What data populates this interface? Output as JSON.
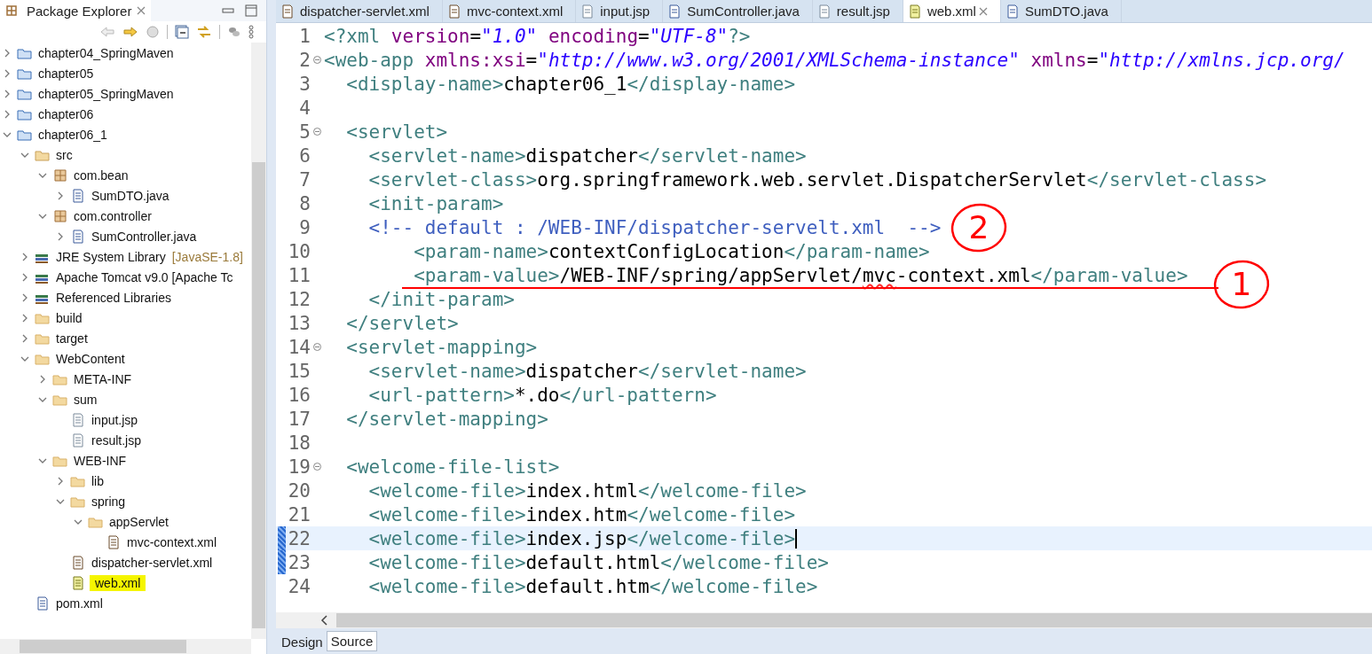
{
  "explorer": {
    "title": "Package Explorer",
    "tree": [
      {
        "label": "chapter04_SpringMaven",
        "kind": "project",
        "expanded": false,
        "selected": false
      },
      {
        "label": "chapter05",
        "kind": "project",
        "expanded": false,
        "selected": false
      },
      {
        "label": "chapter05_SpringMaven",
        "kind": "project",
        "expanded": false,
        "selected": false
      },
      {
        "label": "chapter06",
        "kind": "project",
        "expanded": false,
        "selected": false
      },
      {
        "label": "chapter06_1",
        "kind": "project",
        "expanded": true,
        "selected": false,
        "children": [
          {
            "label": "src",
            "kind": "src",
            "expanded": true,
            "selected": false,
            "children": [
              {
                "label": "com.bean",
                "kind": "package",
                "expanded": true,
                "selected": false,
                "children": [
                  {
                    "label": "SumDTO.java",
                    "kind": "java",
                    "expanded": false,
                    "selected": false
                  }
                ]
              },
              {
                "label": "com.controller",
                "kind": "package",
                "expanded": true,
                "selected": false,
                "children": [
                  {
                    "label": "SumController.java",
                    "kind": "java",
                    "expanded": false,
                    "selected": false
                  }
                ]
              }
            ]
          },
          {
            "label": "JRE System Library",
            "decoration": "[JavaSE-1.8]",
            "kind": "library",
            "expanded": false,
            "selected": false
          },
          {
            "label": "Apache Tomcat v9.0 [Apache Tc",
            "kind": "library",
            "expanded": false,
            "selected": false
          },
          {
            "label": "Referenced Libraries",
            "kind": "library",
            "expanded": false,
            "selected": false
          },
          {
            "label": "build",
            "kind": "folder",
            "expanded": false,
            "selected": false
          },
          {
            "label": "target",
            "kind": "folder",
            "expanded": false,
            "selected": false
          },
          {
            "label": "WebContent",
            "kind": "folder",
            "expanded": true,
            "selected": false,
            "children": [
              {
                "label": "META-INF",
                "kind": "folder",
                "expanded": false,
                "selected": false
              },
              {
                "label": "sum",
                "kind": "folder",
                "expanded": true,
                "selected": false,
                "children": [
                  {
                    "label": "input.jsp",
                    "kind": "jsp",
                    "selected": false
                  },
                  {
                    "label": "result.jsp",
                    "kind": "jsp",
                    "selected": false
                  }
                ]
              },
              {
                "label": "WEB-INF",
                "kind": "folder",
                "expanded": true,
                "selected": false,
                "children": [
                  {
                    "label": "lib",
                    "kind": "folder",
                    "expanded": false,
                    "selected": false
                  },
                  {
                    "label": "spring",
                    "kind": "folder",
                    "expanded": true,
                    "selected": false,
                    "children": [
                      {
                        "label": "appServlet",
                        "kind": "folder",
                        "expanded": true,
                        "selected": false,
                        "children": [
                          {
                            "label": "mvc-context.xml",
                            "kind": "spring",
                            "selected": false
                          }
                        ]
                      }
                    ]
                  },
                  {
                    "label": "dispatcher-servlet.xml",
                    "kind": "spring",
                    "selected": false
                  },
                  {
                    "label": "web.xml",
                    "kind": "xml",
                    "selected": true
                  }
                ]
              }
            ]
          },
          {
            "label": "pom.xml",
            "kind": "pom",
            "selected": false
          }
        ]
      }
    ]
  },
  "tabs": [
    {
      "label": "dispatcher-servlet.xml",
      "kind": "spring",
      "selected": false
    },
    {
      "label": "mvc-context.xml",
      "kind": "spring",
      "selected": false
    },
    {
      "label": "input.jsp",
      "kind": "jsp",
      "selected": false
    },
    {
      "label": "SumController.java",
      "kind": "java",
      "selected": false
    },
    {
      "label": "result.jsp",
      "kind": "jsp",
      "selected": false
    },
    {
      "label": "web.xml",
      "kind": "xml",
      "selected": true
    },
    {
      "label": "SumDTO.java",
      "kind": "java",
      "selected": false
    }
  ],
  "lines": [
    {
      "n": "1",
      "current": false,
      "changed": false,
      "tokens": [
        {
          "kind": "tag",
          "t": "<?xml "
        },
        {
          "kind": "attr",
          "t": "version"
        },
        {
          "kind": "eq",
          "t": "="
        },
        {
          "kind": "str",
          "t": "\"1.0\""
        },
        {
          "kind": "attr",
          "t": " encoding"
        },
        {
          "kind": "eq",
          "t": "="
        },
        {
          "kind": "str",
          "t": "\"UTF-8\""
        },
        {
          "kind": "tag",
          "t": "?>"
        }
      ]
    },
    {
      "n": "2",
      "fold": true,
      "current": false,
      "changed": false,
      "tokens": [
        {
          "kind": "tag",
          "t": "<web-app "
        },
        {
          "kind": "attr",
          "t": "xmlns:xsi"
        },
        {
          "kind": "eq",
          "t": "="
        },
        {
          "kind": "str",
          "t": "\"http://www.w3.org/2001/XMLSchema-instance\""
        },
        {
          "kind": "attr",
          "t": " xmlns"
        },
        {
          "kind": "eq",
          "t": "="
        },
        {
          "kind": "str",
          "t": "\"http://xmlns.jcp.org/"
        }
      ]
    },
    {
      "n": "3",
      "current": false,
      "changed": false,
      "tokens": [
        {
          "kind": "tag",
          "t": "  <display-name>"
        },
        {
          "kind": "text",
          "t": "chapter06_1"
        },
        {
          "kind": "tag",
          "t": "</display-name>"
        }
      ]
    },
    {
      "n": "4",
      "current": false,
      "changed": false
    },
    {
      "n": "5",
      "fold": true,
      "current": false,
      "changed": false,
      "tokens": [
        {
          "kind": "tag",
          "t": "  <servlet>"
        }
      ]
    },
    {
      "n": "6",
      "current": false,
      "changed": false,
      "tokens": [
        {
          "kind": "tag",
          "t": "    <servlet-name>"
        },
        {
          "kind": "text",
          "t": "dispatcher"
        },
        {
          "kind": "tag",
          "t": "</servlet-name>"
        }
      ]
    },
    {
      "n": "7",
      "current": false,
      "changed": false,
      "tokens": [
        {
          "kind": "tag",
          "t": "    <servlet-class>"
        },
        {
          "kind": "text",
          "t": "org.springframework.web.servlet.DispatcherServlet"
        },
        {
          "kind": "tag",
          "t": "</servlet-class>"
        }
      ]
    },
    {
      "n": "8",
      "current": false,
      "changed": false,
      "tokens": [
        {
          "kind": "tag",
          "t": "    <init-param>"
        }
      ]
    },
    {
      "n": "9",
      "current": false,
      "changed": false,
      "note": "2",
      "tokens": [
        {
          "kind": "comment",
          "t": "    <!-- default : /WEB-INF/dispatcher-servelt.xml  -->"
        }
      ]
    },
    {
      "n": "10",
      "current": false,
      "changed": false,
      "tokens": [
        {
          "kind": "tag",
          "t": "        <param-name>"
        },
        {
          "kind": "text",
          "t": "contextConfigLocation"
        },
        {
          "kind": "tag",
          "t": "</param-name>"
        }
      ]
    },
    {
      "n": "11",
      "current": false,
      "changed": false,
      "note": "1",
      "underlined": true,
      "tokens": [
        {
          "kind": "tag",
          "t": "        <param-value>"
        },
        {
          "kind": "text",
          "t": "/WEB-INF/spring/appServlet/"
        },
        {
          "kind": "spell",
          "t": "mvc"
        },
        {
          "kind": "text",
          "t": "-context.xml"
        },
        {
          "kind": "tag",
          "t": "</param-value>"
        }
      ]
    },
    {
      "n": "12",
      "current": false,
      "changed": false,
      "tokens": [
        {
          "kind": "tag",
          "t": "    </init-param>"
        }
      ]
    },
    {
      "n": "13",
      "current": false,
      "changed": false,
      "tokens": [
        {
          "kind": "tag",
          "t": "  </servlet>"
        }
      ]
    },
    {
      "n": "14",
      "fold": true,
      "current": false,
      "changed": false,
      "tokens": [
        {
          "kind": "tag",
          "t": "  <servlet-mapping>"
        }
      ]
    },
    {
      "n": "15",
      "current": false,
      "changed": false,
      "tokens": [
        {
          "kind": "tag",
          "t": "    <servlet-name>"
        },
        {
          "kind": "text",
          "t": "dispatcher"
        },
        {
          "kind": "tag",
          "t": "</servlet-name>"
        }
      ]
    },
    {
      "n": "16",
      "current": false,
      "changed": false,
      "tokens": [
        {
          "kind": "tag",
          "t": "    <url-pattern>"
        },
        {
          "kind": "text",
          "t": "*.do"
        },
        {
          "kind": "tag",
          "t": "</url-pattern>"
        }
      ]
    },
    {
      "n": "17",
      "current": false,
      "changed": false,
      "tokens": [
        {
          "kind": "tag",
          "t": "  </servlet-mapping>"
        }
      ]
    },
    {
      "n": "18",
      "current": false,
      "changed": false
    },
    {
      "n": "19",
      "fold": true,
      "current": false,
      "changed": false,
      "tokens": [
        {
          "kind": "tag",
          "t": "  <welcome-file-list>"
        }
      ]
    },
    {
      "n": "20",
      "current": false,
      "changed": false,
      "tokens": [
        {
          "kind": "tag",
          "t": "    <welcome-file>"
        },
        {
          "kind": "text",
          "t": "index.html"
        },
        {
          "kind": "tag",
          "t": "</welcome-file>"
        }
      ]
    },
    {
      "n": "21",
      "current": false,
      "changed": false,
      "tokens": [
        {
          "kind": "tag",
          "t": "    <welcome-file>"
        },
        {
          "kind": "text",
          "t": "index.htm"
        },
        {
          "kind": "tag",
          "t": "</welcome-file>"
        }
      ]
    },
    {
      "n": "22",
      "current": true,
      "changed": true,
      "tokens": [
        {
          "kind": "tag",
          "t": "    <welcome-file>"
        },
        {
          "kind": "text",
          "t": "index.jsp"
        },
        {
          "kind": "tag",
          "t": "</welcome-file>"
        }
      ]
    },
    {
      "n": "23",
      "current": false,
      "changed": true,
      "tokens": [
        {
          "kind": "tag",
          "t": "    <welcome-file>"
        },
        {
          "kind": "text",
          "t": "default.html"
        },
        {
          "kind": "tag",
          "t": "</welcome-file>"
        }
      ]
    },
    {
      "n": "24",
      "current": false,
      "changed": false,
      "tokens": [
        {
          "kind": "tag",
          "t": "    <welcome-file>"
        },
        {
          "kind": "text",
          "t": "default.htm"
        },
        {
          "kind": "tag",
          "t": "</welcome-file>"
        }
      ]
    }
  ],
  "bottom_tabs": [
    {
      "label": "Design",
      "selected": false
    },
    {
      "label": "Source",
      "selected": true
    }
  ]
}
